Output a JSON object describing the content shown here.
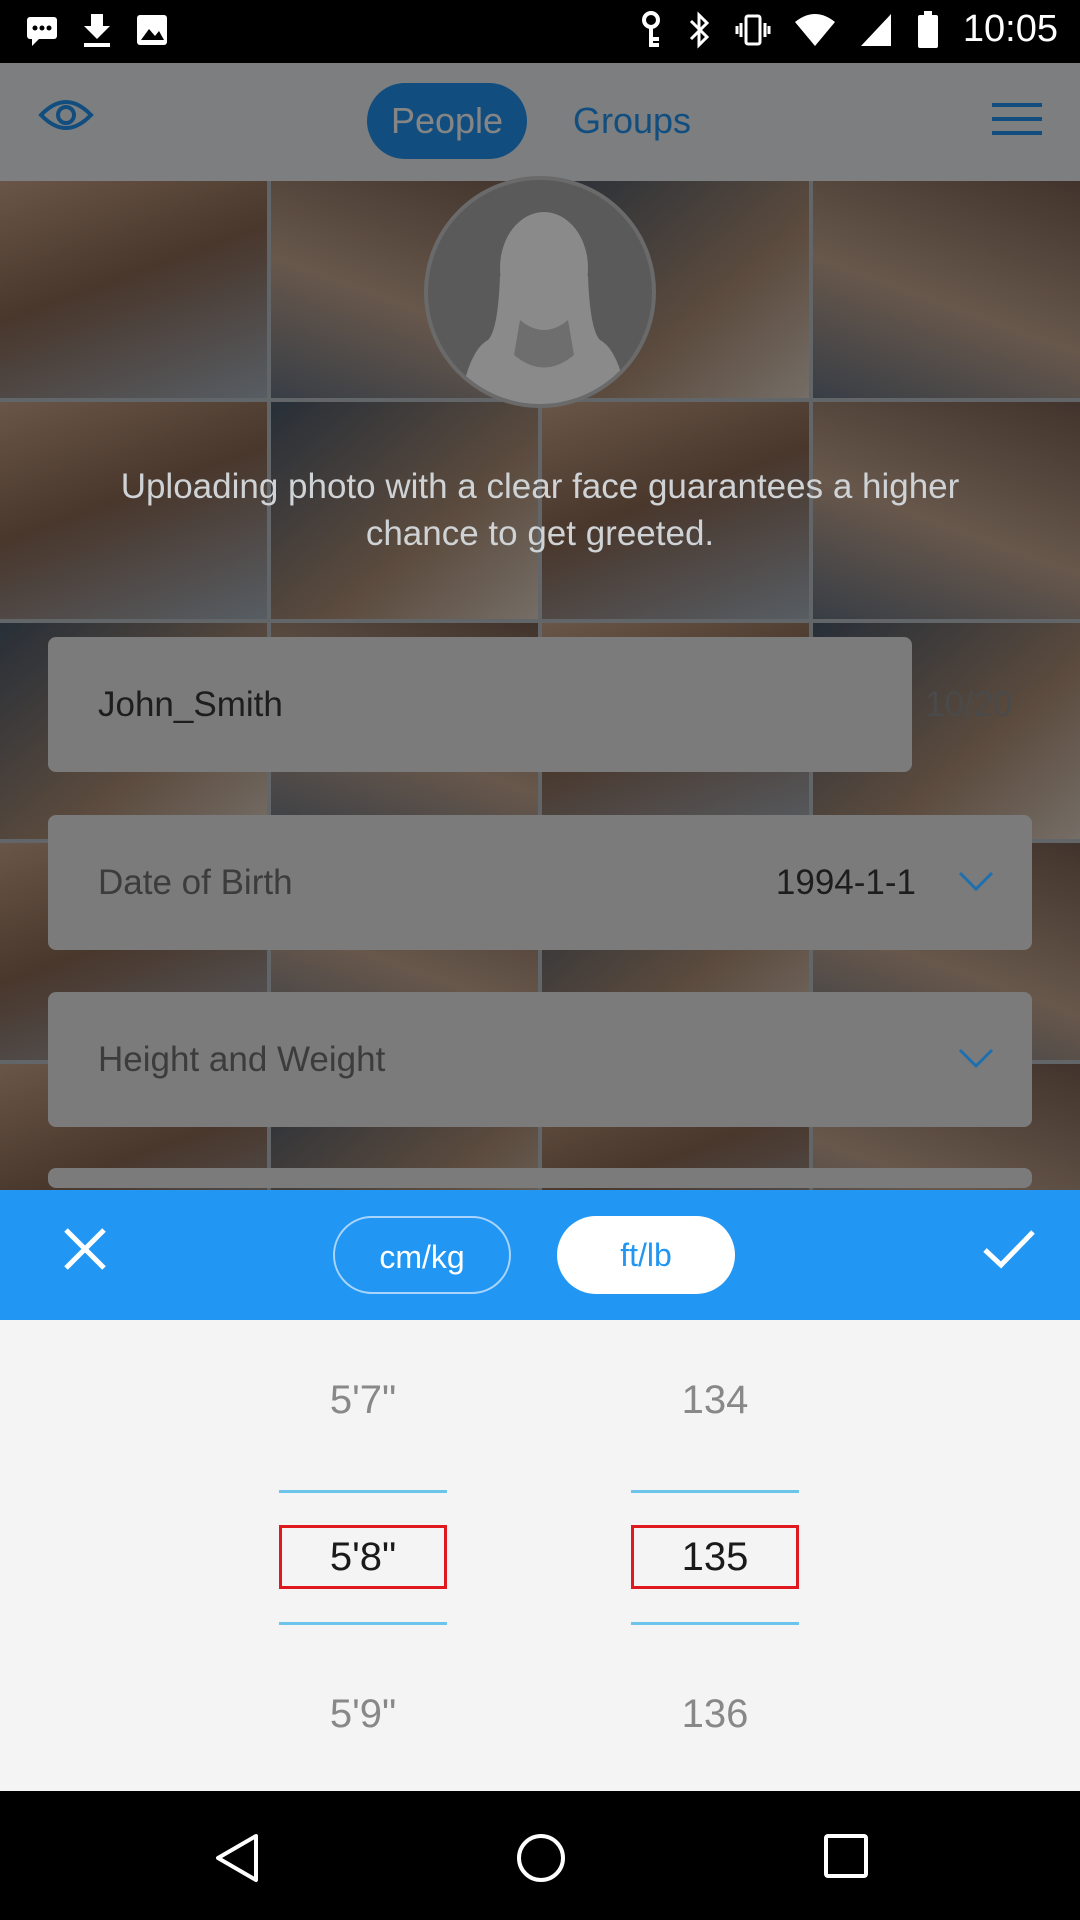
{
  "status_bar": {
    "time": "10:05",
    "icons": [
      "message-icon",
      "download-icon",
      "image-icon",
      "vpn-key-icon",
      "bluetooth-icon",
      "vibrate-icon",
      "wifi-icon",
      "signal-icon",
      "battery-icon"
    ]
  },
  "top_bar": {
    "tabs": [
      {
        "label": "People",
        "active": true
      },
      {
        "label": "Groups",
        "active": false
      }
    ]
  },
  "profile": {
    "hint": "Uploading photo with a clear face guarantees a higher chance to get greeted.",
    "username": "John_Smith",
    "username_counter": "10/20",
    "dob_label": "Date of Birth",
    "dob_value": "1994-1-1",
    "height_weight_label": "Height and Weight"
  },
  "picker": {
    "units": [
      {
        "label": "cm/kg",
        "selected": false
      },
      {
        "label": "ft/lb",
        "selected": true
      }
    ],
    "height": {
      "prev": "5'7\"",
      "selected": "5'8\"",
      "next": "5'9\""
    },
    "weight": {
      "prev": "134",
      "selected": "135",
      "next": "136"
    }
  },
  "colors": {
    "accent": "#2196f3",
    "selection_outline": "#e0191e"
  }
}
